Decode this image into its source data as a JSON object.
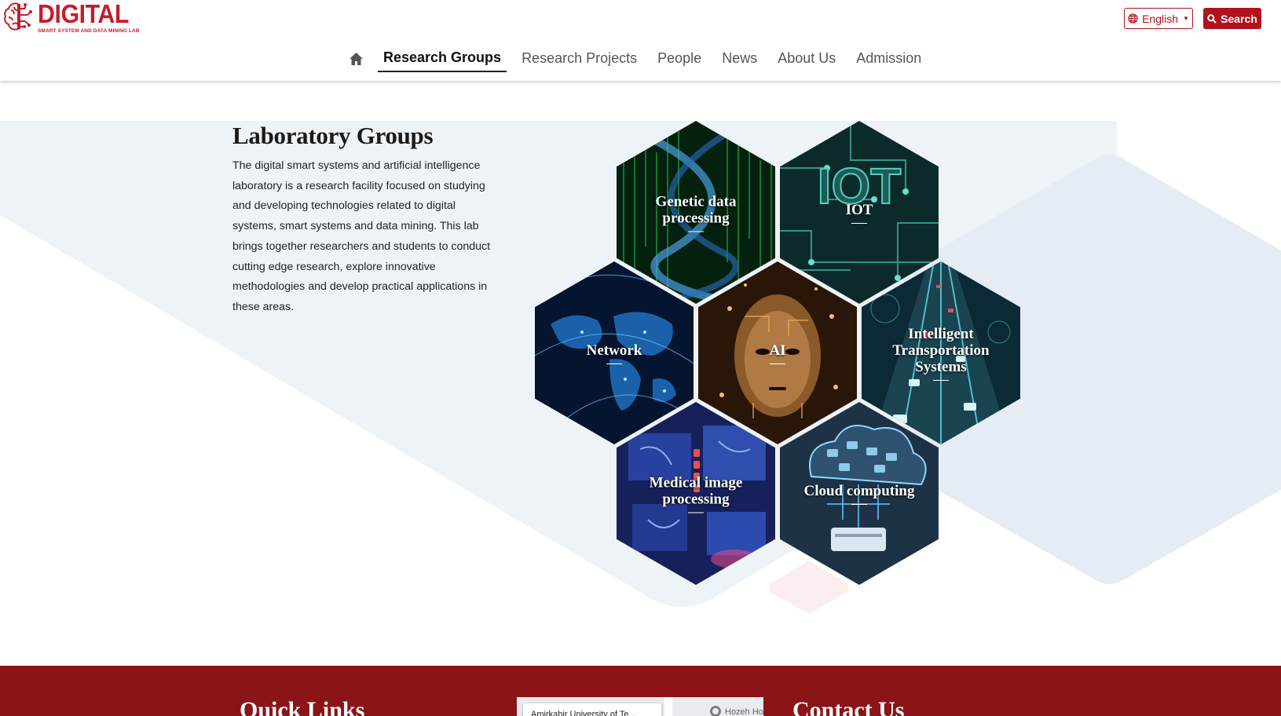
{
  "brand": {
    "title": "DIGITAL",
    "tagline": "SMART SYSTEM AND DATA MINING LAB",
    "color": "#c41e2a"
  },
  "header": {
    "language_label": "English",
    "search_label": "Search"
  },
  "nav": {
    "home_icon": "home-icon",
    "items": [
      {
        "label": "Research Groups",
        "active": true
      },
      {
        "label": "Research Projects",
        "active": false
      },
      {
        "label": "People",
        "active": false
      },
      {
        "label": "News",
        "active": false
      },
      {
        "label": "About Us",
        "active": false
      },
      {
        "label": "Admission",
        "active": false
      }
    ]
  },
  "intro": {
    "title": "Laboratory Groups",
    "text": "The digital smart systems and artificial intelligence laboratory is a research facility focused on studying and developing technologies related to digital systems, smart systems and data mining. This lab brings together researchers and students to conduct cutting edge research, explore innovative methodologies and develop practical applications in these areas."
  },
  "groups": [
    {
      "label": "Genetic data processing",
      "theme": "dna-matrix"
    },
    {
      "label": "IOT",
      "theme": "circuit-board"
    },
    {
      "label": "Network",
      "theme": "world-map"
    },
    {
      "label": "AI",
      "theme": "robot-face"
    },
    {
      "label": "Intelligent Transportation Systems",
      "theme": "highway"
    },
    {
      "label": "Medical image processing",
      "theme": "x-ray"
    },
    {
      "label": "Cloud computing",
      "theme": "cloud"
    }
  ],
  "footer": {
    "quick_links_title": "Quick Links",
    "contact_title": "Contact Us",
    "map_card_text": "Amirkabir University of Te...",
    "map_place": "Hozeh Ho"
  },
  "colors": {
    "accent": "#b0131e",
    "footer_bg": "#8b1419",
    "panel_bg": "#eef3f8"
  }
}
